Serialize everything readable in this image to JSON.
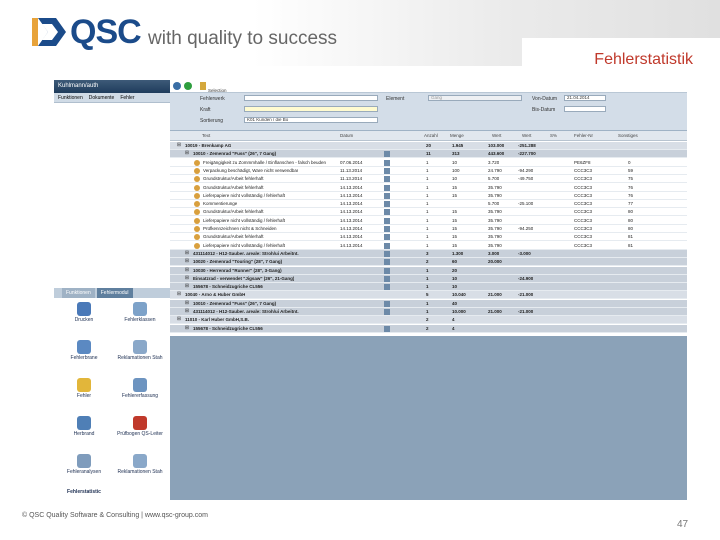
{
  "header": {
    "brand": "QSC",
    "tagline": "with quality to success",
    "slide_title": "Fehlerstatistik"
  },
  "footer": {
    "copyright": "© QSC Quality Software & Consulting | www.qsc-group.com",
    "page_number": "47"
  },
  "app": {
    "window_title": "Kuhlmann/auth",
    "menu": [
      "Funktionen",
      "Dokumente",
      "Fehler"
    ],
    "nav_tabs": [
      "Funktionen",
      "Fehlermodul"
    ],
    "nav_icons": [
      "Drucken",
      "Fehlerklassen",
      "Fehlerbrane",
      "Reklamationen Stah",
      "Fehler",
      "Fehlererfassung",
      "Herbrand",
      "Prüfbogen QS-Leiter",
      "Fehleranalysen",
      "Reklamationen Stah",
      "Fehlerstatistic"
    ],
    "toolbar": {
      "selection_label": "Selection"
    },
    "filter": {
      "fehlerwerk_label": "Fehlerwerk",
      "fehlerwerk_value": "",
      "gruppe_label": "Element",
      "gruppe_value": "Gang",
      "von_datum_label": "Von-Datum",
      "von_datum_value": "21.04.2014",
      "kraft_label": "Kraft",
      "kraft_value": "",
      "bis_datum_label": "Bis-Datum",
      "bis_datum_value": "",
      "sortierung_label": "Sortierung",
      "sortierung_value": "K01 Kunden / die Bo"
    },
    "grid": {
      "columns": [
        "Text",
        "Datum",
        "",
        "Anzahl",
        "Menge",
        "Wert",
        "Wert",
        "S%",
        "Fehler-Nr",
        "Sonstiges"
      ],
      "rows": [
        {
          "level": 0,
          "text": "10019 - Brenkamp AG",
          "date": "",
          "anzahl": "20",
          "menge": "1.945",
          "wert": "103.000",
          "wert2": "-251.288",
          "code": "",
          "num": ""
        },
        {
          "level": 1,
          "text": "10010 - Zemenrad \"Fuss\" (26\", 7 Gang)",
          "date": "",
          "anzahl": "11",
          "menge": "313",
          "wert": "443.600",
          "wert2": "-227.700",
          "code": "",
          "num": ""
        },
        {
          "level": 2,
          "text": "Freigängigkeit zu Zommmhalle / Einflanschen - falsch beuden",
          "date": "07.06.2014",
          "anzahl": "1",
          "menge": "10",
          "wert": "3.720",
          "wert2": "",
          "code": "PE6ZF8",
          "num": "0"
        },
        {
          "level": 2,
          "text": "Verpackung beschädigt, Ware nicht verwendbar",
          "date": "11.13.2014",
          "anzahl": "1",
          "menge": "100",
          "wert": "24.790",
          "wert2": "-94.290",
          "code": "CCC3C3",
          "num": "59"
        },
        {
          "level": 2,
          "text": "Grundstruktur/Arbeit fehlerhaft",
          "date": "11.13.2014",
          "anzahl": "1",
          "menge": "10",
          "wert": "5.700",
          "wert2": "-49.750",
          "code": "CCC3C3",
          "num": "75"
        },
        {
          "level": 2,
          "text": "Grundstruktur/Arbeit fehlerhaft",
          "date": "14.13.2014",
          "anzahl": "1",
          "menge": "15",
          "wert": "35.790",
          "wert2": "",
          "code": "CCC3C3",
          "num": "76"
        },
        {
          "level": 2,
          "text": "Lieferpapiere nicht vollständig / fehlerhaft",
          "date": "14.13.2014",
          "anzahl": "1",
          "menge": "15",
          "wert": "35.790",
          "wert2": "",
          "code": "CCC3C3",
          "num": "76"
        },
        {
          "level": 2,
          "text": "Kommentierunge",
          "date": "14.13.2014",
          "anzahl": "1",
          "menge": "",
          "wert": "5.700",
          "wert2": "-25.100",
          "code": "CCC3C3",
          "num": "77"
        },
        {
          "level": 2,
          "text": "Grundstruktur/Arbeit fehlerhaft",
          "date": "14.13.2014",
          "anzahl": "1",
          "menge": "15",
          "wert": "35.790",
          "wert2": "",
          "code": "CCC3C3",
          "num": "80"
        },
        {
          "level": 2,
          "text": "Lieferpapiere nicht vollständig / fehlerhaft",
          "date": "14.13.2014",
          "anzahl": "1",
          "menge": "15",
          "wert": "35.790",
          "wert2": "",
          "code": "CCC3C3",
          "num": "80"
        },
        {
          "level": 2,
          "text": "Prüfkennzeichnen nicht & Schneiden",
          "date": "14.13.2014",
          "anzahl": "1",
          "menge": "15",
          "wert": "35.790",
          "wert2": "-94.250",
          "code": "CCC3C3",
          "num": "80"
        },
        {
          "level": 2,
          "text": "Grundstruktur/Arbeit fehlerhaft",
          "date": "14.13.2014",
          "anzahl": "1",
          "menge": "15",
          "wert": "35.790",
          "wert2": "",
          "code": "CCC3C3",
          "num": "81"
        },
        {
          "level": 2,
          "text": "Lieferpapiere nicht vollständig / fehlerhaft",
          "date": "14.13.2014",
          "anzahl": "1",
          "menge": "15",
          "wert": "35.790",
          "wert2": "",
          "code": "CCC3C3",
          "num": "81"
        },
        {
          "level": 1,
          "text": "431114012 - H12-Sauber. areale: Stroh/ui Arbeitnt.",
          "date": "",
          "anzahl": "3",
          "menge": "1.300",
          "wert": "3.000",
          "wert2": "-3.000",
          "code": "",
          "num": ""
        },
        {
          "level": 1,
          "text": "10020 - Zemenrad \"Touring\" (28\", 7 Gang)",
          "date": "",
          "anzahl": "2",
          "menge": "60",
          "wert": "20.000",
          "wert2": "",
          "code": "",
          "num": ""
        },
        {
          "level": 1,
          "text": "10030 - Herrenrad \"Runner\" (28\", 3-Gang)",
          "date": "",
          "anzahl": "1",
          "menge": "20",
          "wert": "",
          "wert2": "",
          "code": "",
          "num": ""
        },
        {
          "level": 1,
          "text": "Einsatzrad - verwendet \"Jigsaw\" (26\", 21-Gang)",
          "date": "",
          "anzahl": "1",
          "menge": "10",
          "wert": "",
          "wert2": "-24.900",
          "code": "",
          "num": ""
        },
        {
          "level": 1,
          "text": "155678 - Schneidzugriche CL556",
          "date": "",
          "anzahl": "1",
          "menge": "10",
          "wert": "",
          "wert2": "",
          "code": "",
          "num": ""
        },
        {
          "level": 0,
          "text": "10040 - Arno & Huber GmbH",
          "date": "",
          "anzahl": "5",
          "menge": "10.040",
          "wert": "21.000",
          "wert2": "-21.000",
          "code": "",
          "num": ""
        },
        {
          "level": 1,
          "text": "10010 - Zemenrad \"Fuss\" (26\", 7 Gang)",
          "date": "",
          "anzahl": "1",
          "menge": "40",
          "wert": "",
          "wert2": "",
          "code": "",
          "num": ""
        },
        {
          "level": 1,
          "text": "431114012 - H12-Sauber. areale: Stroh/ui Arbeitnt.",
          "date": "",
          "anzahl": "1",
          "menge": "10.000",
          "wert": "21.000",
          "wert2": "-21.000",
          "code": "",
          "num": ""
        },
        {
          "level": 0,
          "text": "11010 - Karl Huber GmbH,S.B.",
          "date": "",
          "anzahl": "2",
          "menge": "4",
          "wert": "",
          "wert2": "",
          "code": "",
          "num": ""
        },
        {
          "level": 1,
          "text": "155678 - Schneidzugriche CL556",
          "date": "",
          "anzahl": "2",
          "menge": "4",
          "wert": "",
          "wert2": "",
          "code": "",
          "num": ""
        }
      ]
    }
  },
  "colors": {
    "brand_blue": "#1b4b8a",
    "title_red": "#c0392b",
    "app_bg": "#8ba2b8"
  }
}
